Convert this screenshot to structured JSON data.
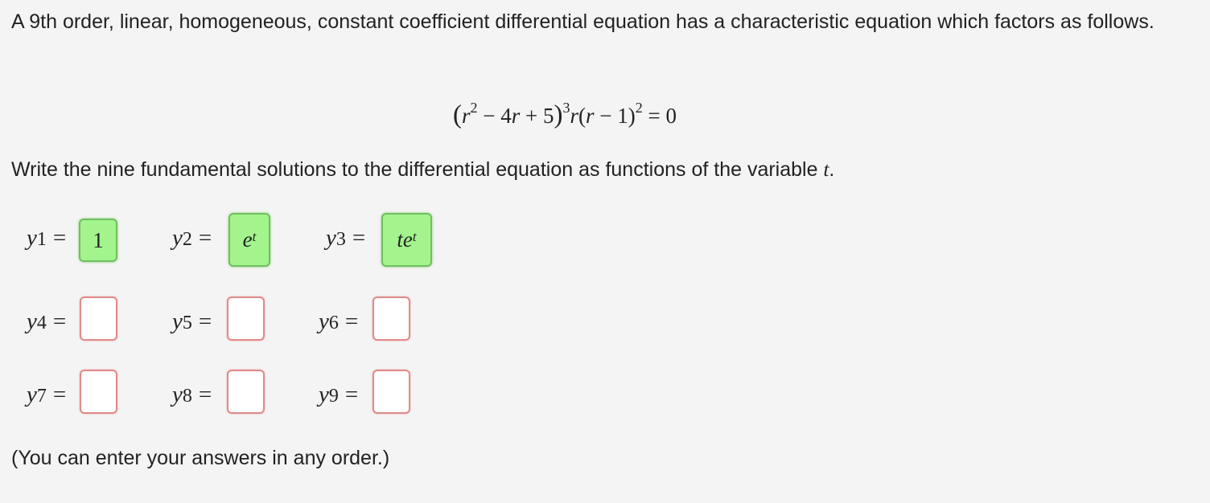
{
  "question": {
    "intro": "A 9th order, linear, homogeneous, constant coefficient differential equation has a characteristic equation which factors as follows.",
    "write_prefix": "Write the nine fundamental solutions to the differential equation as functions of the variable ",
    "write_var": "t",
    "write_suffix": ".",
    "note": "(You can enter your answers in any order.)"
  },
  "equation": {
    "p1": "(",
    "r": "r",
    "exp2": "2",
    "minus": " − 4",
    "r2": "r",
    "plus5": " + 5",
    "p2": ")",
    "exp3": "3",
    "r3": "r",
    "open": "(",
    "r4": "r",
    "minus1": " − 1)",
    "exp4": "2",
    "eq0": " = 0"
  },
  "answers": [
    {
      "var": "y",
      "idx": "1",
      "eq": "=",
      "status": "correct",
      "value": "1"
    },
    {
      "var": "y",
      "idx": "2",
      "eq": "=",
      "status": "correct",
      "base": "e",
      "exp": "t"
    },
    {
      "var": "y",
      "idx": "3",
      "eq": "=",
      "status": "correct",
      "base": "te",
      "exp": "t"
    },
    {
      "var": "y",
      "idx": "4",
      "eq": "=",
      "status": "empty"
    },
    {
      "var": "y",
      "idx": "5",
      "eq": "=",
      "status": "empty"
    },
    {
      "var": "y",
      "idx": "6",
      "eq": "=",
      "status": "empty"
    },
    {
      "var": "y",
      "idx": "7",
      "eq": "=",
      "status": "empty"
    },
    {
      "var": "y",
      "idx": "8",
      "eq": "=",
      "status": "empty"
    },
    {
      "var": "y",
      "idx": "9",
      "eq": "=",
      "status": "empty"
    }
  ],
  "colors": {
    "background": "#f4f4f4",
    "correct_fill": "#a3f48d",
    "correct_border": "#6fbf5f",
    "empty_border": "#e08a8a"
  }
}
